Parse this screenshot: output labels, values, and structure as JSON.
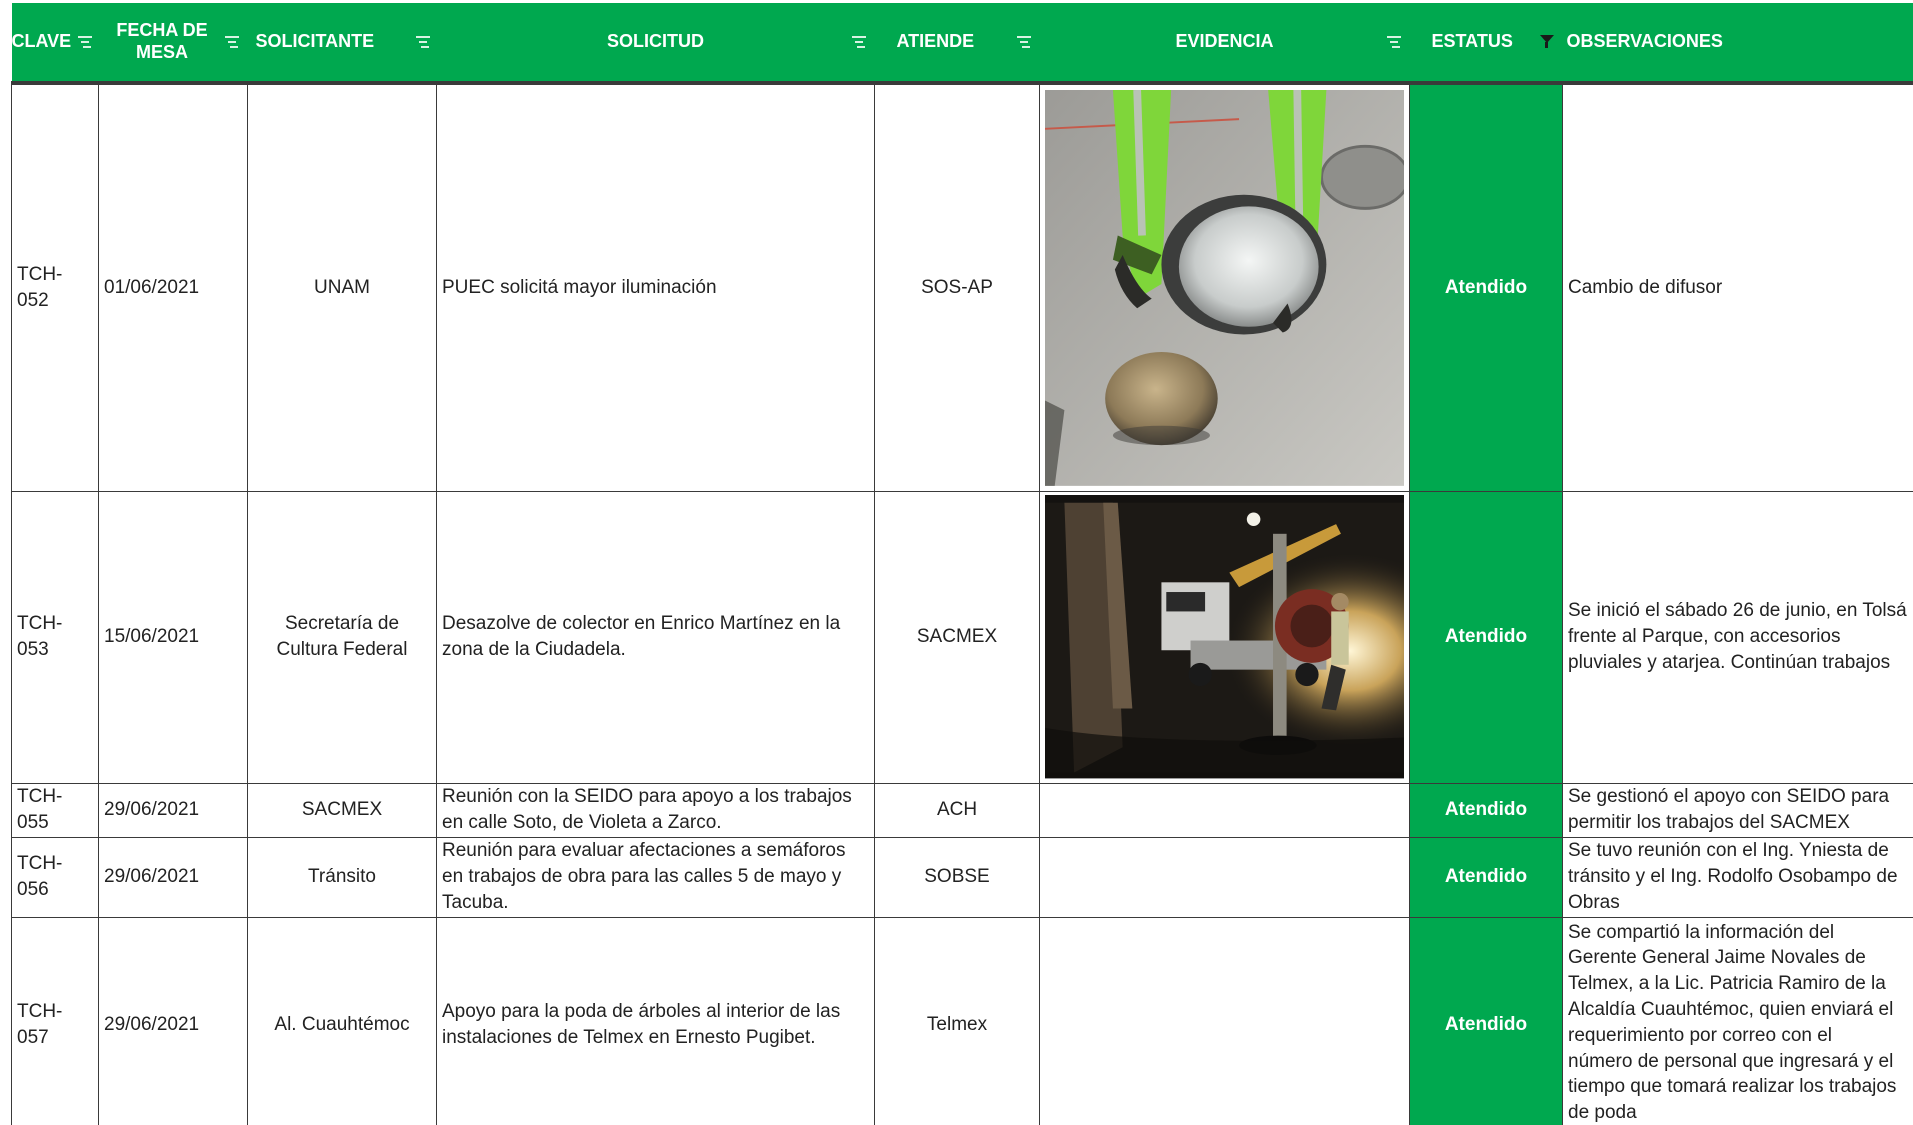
{
  "columns": [
    {
      "label": "CLAVE"
    },
    {
      "label": "FECHA DE MESA"
    },
    {
      "label": "SOLICITANTE"
    },
    {
      "label": "SOLICITUD"
    },
    {
      "label": "ATIENDE"
    },
    {
      "label": "EVIDENCIA"
    },
    {
      "label": "ESTATUS",
      "filter_active": true
    },
    {
      "label": "OBSERVACIONES"
    }
  ],
  "rows": [
    {
      "clave": "TCH-052",
      "fecha": "01/06/2021",
      "solicitante": "UNAM",
      "solicitud": "PUEC solicitá mayor iluminación",
      "atiende": "SOS-AP",
      "evidencia": "photo-street-lamp-diffuser",
      "estatus": "Atendido",
      "observaciones": [
        "Cambio de difusor"
      ]
    },
    {
      "clave": "TCH-053",
      "fecha": "15/06/2021",
      "solicitante": "Secretaría de Cultura Federal",
      "solicitud": "Desazolve de colector en Enrico Martínez en la zona de la Ciudadela.",
      "atiende": "SACMEX",
      "evidencia": "photo-night-sewer-truck",
      "estatus": "Atendido",
      "observaciones": [
        "Se inició el sábado 26 de junio, en Tolsá",
        "frente al Parque, con accesorios",
        "pluviales y atarjea. Continúan trabajos"
      ]
    },
    {
      "clave": "TCH-055",
      "fecha": "29/06/2021",
      "solicitante": "SACMEX",
      "solicitud": "Reunión con la SEIDO para apoyo a los trabajos en calle Soto, de Violeta a Zarco.",
      "atiende": "ACH",
      "evidencia": "",
      "estatus": "Atendido",
      "observaciones": [
        "Se gestionó el apoyo con SEIDO para",
        "permitir los trabajos del SACMEX"
      ]
    },
    {
      "clave": "TCH-056",
      "fecha": "29/06/2021",
      "solicitante": "Tránsito",
      "solicitud": "Reunión para evaluar afectaciones a semáforos en trabajos de obra para las calles 5 de mayo y Tacuba.",
      "atiende": "SOBSE",
      "evidencia": "",
      "estatus": "Atendido",
      "observaciones": [
        "Se tuvo reunión con el Ing. Yniesta de",
        "tránsito y el Ing. Rodolfo Osobampo de",
        "Obras"
      ]
    },
    {
      "clave": "TCH-057",
      "fecha": "29/06/2021",
      "solicitante": "Al. Cuauhtémoc",
      "solicitud": "Apoyo para la poda de árboles al interior de las instalaciones de Telmex en Ernesto Pugibet.",
      "atiende": "Telmex",
      "evidencia": "",
      "estatus": "Atendido",
      "observaciones": [
        "Se compartió la información del",
        "Gerente General Jaime Novales de",
        "Telmex, a la Lic. Patricia Ramiro de la",
        "Alcaldía Cuauhtémoc, quien enviará el",
        "requerimiento por correo con el",
        "número de personal que ingresará y el",
        "tiempo que tomará realizar los trabajos",
        "de poda"
      ]
    }
  ],
  "colors": {
    "header_green": "#00a84f",
    "status_green": "#00a84f",
    "border": "#3a3a3a"
  }
}
